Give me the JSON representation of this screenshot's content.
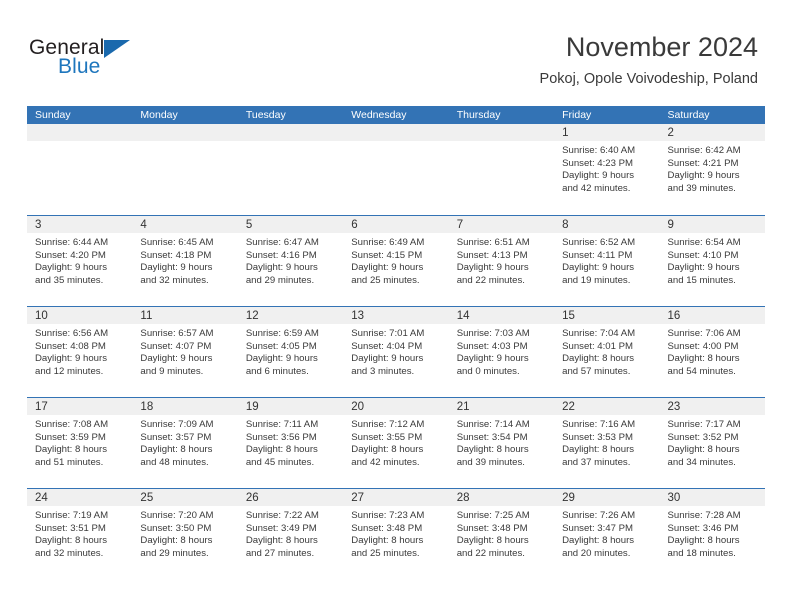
{
  "logo": {
    "word_top": "General",
    "word_bottom": "Blue",
    "accent_color": "#1a69ad"
  },
  "header": {
    "title": "November 2024",
    "subtitle": "Pokoj, Opole Voivodeship, Poland"
  },
  "theme": {
    "header_blue": "#3373b5",
    "day_band_gray": "#f0f0f0",
    "text_color": "#3a3a3a"
  },
  "weekdays": [
    "Sunday",
    "Monday",
    "Tuesday",
    "Wednesday",
    "Thursday",
    "Friday",
    "Saturday"
  ],
  "weeks": [
    [
      {
        "day": "",
        "empty": true
      },
      {
        "day": "",
        "empty": true
      },
      {
        "day": "",
        "empty": true
      },
      {
        "day": "",
        "empty": true
      },
      {
        "day": "",
        "empty": true
      },
      {
        "day": "1",
        "sunrise": "Sunrise: 6:40 AM",
        "sunset": "Sunset: 4:23 PM",
        "daylight1": "Daylight: 9 hours",
        "daylight2": "and 42 minutes."
      },
      {
        "day": "2",
        "sunrise": "Sunrise: 6:42 AM",
        "sunset": "Sunset: 4:21 PM",
        "daylight1": "Daylight: 9 hours",
        "daylight2": "and 39 minutes."
      }
    ],
    [
      {
        "day": "3",
        "sunrise": "Sunrise: 6:44 AM",
        "sunset": "Sunset: 4:20 PM",
        "daylight1": "Daylight: 9 hours",
        "daylight2": "and 35 minutes."
      },
      {
        "day": "4",
        "sunrise": "Sunrise: 6:45 AM",
        "sunset": "Sunset: 4:18 PM",
        "daylight1": "Daylight: 9 hours",
        "daylight2": "and 32 minutes."
      },
      {
        "day": "5",
        "sunrise": "Sunrise: 6:47 AM",
        "sunset": "Sunset: 4:16 PM",
        "daylight1": "Daylight: 9 hours",
        "daylight2": "and 29 minutes."
      },
      {
        "day": "6",
        "sunrise": "Sunrise: 6:49 AM",
        "sunset": "Sunset: 4:15 PM",
        "daylight1": "Daylight: 9 hours",
        "daylight2": "and 25 minutes."
      },
      {
        "day": "7",
        "sunrise": "Sunrise: 6:51 AM",
        "sunset": "Sunset: 4:13 PM",
        "daylight1": "Daylight: 9 hours",
        "daylight2": "and 22 minutes."
      },
      {
        "day": "8",
        "sunrise": "Sunrise: 6:52 AM",
        "sunset": "Sunset: 4:11 PM",
        "daylight1": "Daylight: 9 hours",
        "daylight2": "and 19 minutes."
      },
      {
        "day": "9",
        "sunrise": "Sunrise: 6:54 AM",
        "sunset": "Sunset: 4:10 PM",
        "daylight1": "Daylight: 9 hours",
        "daylight2": "and 15 minutes."
      }
    ],
    [
      {
        "day": "10",
        "sunrise": "Sunrise: 6:56 AM",
        "sunset": "Sunset: 4:08 PM",
        "daylight1": "Daylight: 9 hours",
        "daylight2": "and 12 minutes."
      },
      {
        "day": "11",
        "sunrise": "Sunrise: 6:57 AM",
        "sunset": "Sunset: 4:07 PM",
        "daylight1": "Daylight: 9 hours",
        "daylight2": "and 9 minutes."
      },
      {
        "day": "12",
        "sunrise": "Sunrise: 6:59 AM",
        "sunset": "Sunset: 4:05 PM",
        "daylight1": "Daylight: 9 hours",
        "daylight2": "and 6 minutes."
      },
      {
        "day": "13",
        "sunrise": "Sunrise: 7:01 AM",
        "sunset": "Sunset: 4:04 PM",
        "daylight1": "Daylight: 9 hours",
        "daylight2": "and 3 minutes."
      },
      {
        "day": "14",
        "sunrise": "Sunrise: 7:03 AM",
        "sunset": "Sunset: 4:03 PM",
        "daylight1": "Daylight: 9 hours",
        "daylight2": "and 0 minutes."
      },
      {
        "day": "15",
        "sunrise": "Sunrise: 7:04 AM",
        "sunset": "Sunset: 4:01 PM",
        "daylight1": "Daylight: 8 hours",
        "daylight2": "and 57 minutes."
      },
      {
        "day": "16",
        "sunrise": "Sunrise: 7:06 AM",
        "sunset": "Sunset: 4:00 PM",
        "daylight1": "Daylight: 8 hours",
        "daylight2": "and 54 minutes."
      }
    ],
    [
      {
        "day": "17",
        "sunrise": "Sunrise: 7:08 AM",
        "sunset": "Sunset: 3:59 PM",
        "daylight1": "Daylight: 8 hours",
        "daylight2": "and 51 minutes."
      },
      {
        "day": "18",
        "sunrise": "Sunrise: 7:09 AM",
        "sunset": "Sunset: 3:57 PM",
        "daylight1": "Daylight: 8 hours",
        "daylight2": "and 48 minutes."
      },
      {
        "day": "19",
        "sunrise": "Sunrise: 7:11 AM",
        "sunset": "Sunset: 3:56 PM",
        "daylight1": "Daylight: 8 hours",
        "daylight2": "and 45 minutes."
      },
      {
        "day": "20",
        "sunrise": "Sunrise: 7:12 AM",
        "sunset": "Sunset: 3:55 PM",
        "daylight1": "Daylight: 8 hours",
        "daylight2": "and 42 minutes."
      },
      {
        "day": "21",
        "sunrise": "Sunrise: 7:14 AM",
        "sunset": "Sunset: 3:54 PM",
        "daylight1": "Daylight: 8 hours",
        "daylight2": "and 39 minutes."
      },
      {
        "day": "22",
        "sunrise": "Sunrise: 7:16 AM",
        "sunset": "Sunset: 3:53 PM",
        "daylight1": "Daylight: 8 hours",
        "daylight2": "and 37 minutes."
      },
      {
        "day": "23",
        "sunrise": "Sunrise: 7:17 AM",
        "sunset": "Sunset: 3:52 PM",
        "daylight1": "Daylight: 8 hours",
        "daylight2": "and 34 minutes."
      }
    ],
    [
      {
        "day": "24",
        "sunrise": "Sunrise: 7:19 AM",
        "sunset": "Sunset: 3:51 PM",
        "daylight1": "Daylight: 8 hours",
        "daylight2": "and 32 minutes."
      },
      {
        "day": "25",
        "sunrise": "Sunrise: 7:20 AM",
        "sunset": "Sunset: 3:50 PM",
        "daylight1": "Daylight: 8 hours",
        "daylight2": "and 29 minutes."
      },
      {
        "day": "26",
        "sunrise": "Sunrise: 7:22 AM",
        "sunset": "Sunset: 3:49 PM",
        "daylight1": "Daylight: 8 hours",
        "daylight2": "and 27 minutes."
      },
      {
        "day": "27",
        "sunrise": "Sunrise: 7:23 AM",
        "sunset": "Sunset: 3:48 PM",
        "daylight1": "Daylight: 8 hours",
        "daylight2": "and 25 minutes."
      },
      {
        "day": "28",
        "sunrise": "Sunrise: 7:25 AM",
        "sunset": "Sunset: 3:48 PM",
        "daylight1": "Daylight: 8 hours",
        "daylight2": "and 22 minutes."
      },
      {
        "day": "29",
        "sunrise": "Sunrise: 7:26 AM",
        "sunset": "Sunset: 3:47 PM",
        "daylight1": "Daylight: 8 hours",
        "daylight2": "and 20 minutes."
      },
      {
        "day": "30",
        "sunrise": "Sunrise: 7:28 AM",
        "sunset": "Sunset: 3:46 PM",
        "daylight1": "Daylight: 8 hours",
        "daylight2": "and 18 minutes."
      }
    ]
  ]
}
